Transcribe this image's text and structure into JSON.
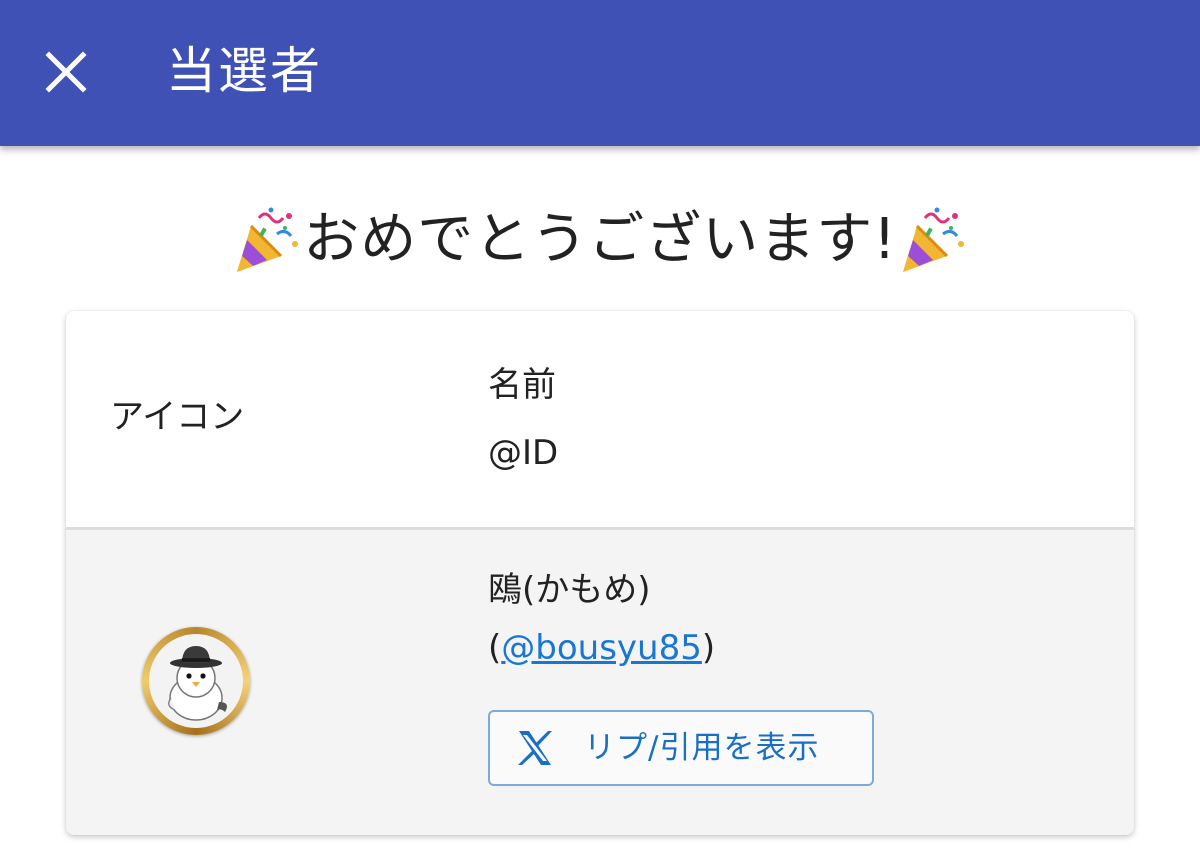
{
  "appbar": {
    "title": "当選者",
    "background_color": "#3f51b5",
    "close_icon": "close-icon"
  },
  "congrats": {
    "text": "おめでとうございます!",
    "emoji_icon": "party-popper-icon"
  },
  "table": {
    "headers": {
      "icon": "アイコン",
      "name": "名前",
      "id": "@ID"
    },
    "rows": [
      {
        "avatar_icon": "seagull-avatar-icon",
        "name": "鴎(かもめ)",
        "handle_prefix": "(",
        "handle": "@bousyu85",
        "handle_suffix": ")",
        "button_label": "リプ/引用を表示",
        "button_icon": "x-logo-icon"
      }
    ]
  },
  "colors": {
    "accent": "#3f51b5",
    "link": "#1976d2",
    "row_bg": "#f4f4f4"
  }
}
